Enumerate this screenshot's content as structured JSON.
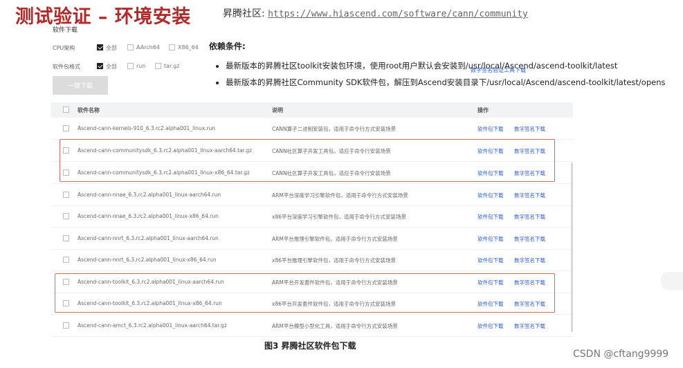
{
  "header": {
    "title": "测试验证 – 环境安装",
    "community_label": "昇腾社区:",
    "community_url": "https://www.hiascend.com/software/cann/community"
  },
  "panel": {
    "section_title": "软件下载",
    "cpu_arch": {
      "label": "CPU架构",
      "options": [
        {
          "text": "全部",
          "checked": true
        },
        {
          "text": "AArch64",
          "checked": false
        },
        {
          "text": "X86_64",
          "checked": false
        }
      ]
    },
    "pkg_format": {
      "label": "软件包格式",
      "options": [
        {
          "text": "全部",
          "checked": true
        },
        {
          "text": "run",
          "checked": false
        },
        {
          "text": "tar.gz",
          "checked": false
        }
      ]
    },
    "download_button": "一键下载",
    "signature_tool_link": "数字签名验证工具下载"
  },
  "dependencies": {
    "title": "依赖条件:",
    "items": [
      "最新版本的昇腾社区toolkit安装包环境，使用root用户默认会安装到/usr/local/Ascend/ascend-toolkit/latest",
      "最新版本的昇腾社区Community SDK软件包，解压到Ascend安装目录下/usr/local/Ascend/ascend-toolkit/latest/opens"
    ]
  },
  "table": {
    "headers": {
      "name": "软件名称",
      "desc": "说明",
      "action": "操作"
    },
    "rows": [
      {
        "name": "Ascend-cann-kernels-910_6.3.rc2.alpha001_linux.run",
        "desc": "CANN算子二进制安装包，适用于命令行方式安装场景",
        "a1": "软件包下载",
        "a2": "数字签名下载"
      },
      {
        "name": "Ascend-cann-communitysdk_6.3.rc2.alpha001_linux-aarch64.tar.gz",
        "desc": "CANN社区算子开发工具包，适应于命令行安装场景",
        "a1": "软件包下载",
        "a2": "数字签名下载"
      },
      {
        "name": "Ascend-cann-communitysdk_6.3.rc2.alpha001_linux-x86_64.tar.gz",
        "desc": "CANN社区算子开发工具包，适应于命令行安装场景",
        "a1": "软件包下载",
        "a2": "数字签名下载"
      },
      {
        "name": "Ascend-cann-nnae_6.3.rc2.alpha001_linux-aarch64.run",
        "desc": "ARM平台深度学习引擎软件包，适用于命令行方式安装场景",
        "a1": "软件包下载",
        "a2": "数字签名下载"
      },
      {
        "name": "Ascend-cann-nnae_6.3.rc2.alpha001_linux-x86_64.run",
        "desc": "x86平台深度学习引擎软件包，适用于命令行方式安装场景",
        "a1": "软件包下载",
        "a2": "数字签名下载"
      },
      {
        "name": "Ascend-cann-nnrt_6.3.rc2.alpha001_linux-aarch64.run",
        "desc": "ARM平台推理引擎软件包，适用于命令行方式安装场景",
        "a1": "软件包下载",
        "a2": "数字签名下载"
      },
      {
        "name": "Ascend-cann-nnrt_6.3.rc2.alpha001_linux-x86_64.run",
        "desc": "x86平台推理引擎软件包，适用于命令行方式安装场景",
        "a1": "软件包下载",
        "a2": "数字签名下载"
      },
      {
        "name": "Ascend-cann-toolkit_6.3.rc2.alpha001_linux-aarch64.run",
        "desc": "ARM平台开发套件软件包，适用于命令行方式安装场景",
        "a1": "软件包下载",
        "a2": "数字签名下载"
      },
      {
        "name": "Ascend-cann-toolkit_6.3.rc2.alpha001_linux-x86_64.run",
        "desc": "x86平台开发套件软件包，适用于命令行方式安装场景",
        "a1": "软件包下载",
        "a2": "数字签名下载"
      },
      {
        "name": "Ascend-cann-amct_6.3.rc2.alpha001_linux-aarch64.tar.gz",
        "desc": "ARM平台模型小型化工具，适用于命令行方式安装场景",
        "a1": "软件包下载",
        "a2": "数字签名下载"
      }
    ]
  },
  "caption": "图3 昇腾社区软件包下载",
  "watermark": "CSDN @cftang9999"
}
